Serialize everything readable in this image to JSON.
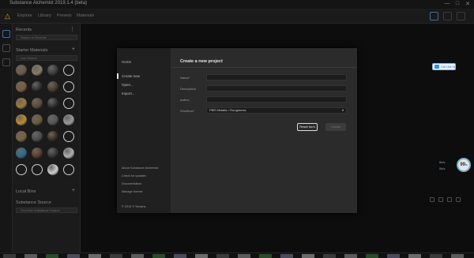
{
  "window": {
    "title": "Substance Alchemist 2019.1.4 (beta)",
    "controls": [
      "—",
      "□",
      "✕"
    ]
  },
  "menu": {
    "items": [
      "Explore",
      "Library",
      "Presets",
      "Materials"
    ]
  },
  "sidebar": {
    "recents_label": "Recents",
    "search_placeholder": "Search in Recents",
    "starter_label": "Starter Materials",
    "starter_search_placeholder": "Use Search",
    "local_label": "Local Bins",
    "source_label": "Substance Source",
    "source_placeholder": "Find free Substance Source"
  },
  "modal": {
    "nav": {
      "home": "Home",
      "create_new": "Create new",
      "open": "Open...",
      "import": "Import..."
    },
    "links": [
      "About Substance Alchemist",
      "Check for updates",
      "Documentation",
      "Manage license"
    ],
    "copyright": "© 2019 X   Terrains",
    "title": "Create a new project",
    "fields": [
      {
        "label": "Name*",
        "value": ""
      },
      {
        "label": "Description",
        "value": ""
      },
      {
        "label": "Author",
        "value": ""
      }
    ],
    "workflow_label": "Workflow*",
    "workflow_value": "PBR Metallic / Roughness",
    "reset_label": "Reset form",
    "create_label": "Create"
  },
  "widgets": {
    "share_label": "Ctrl+Alt+A",
    "perf_value": "99",
    "perf_unit": "%",
    "net_up": "0k/s",
    "net_down": "0k/s"
  },
  "colors": {
    "accent": "#e0a62a",
    "nav_icon": "#3c6fa8",
    "modal_bg": "#2b2b2b",
    "modal_nav_bg": "#202020"
  }
}
